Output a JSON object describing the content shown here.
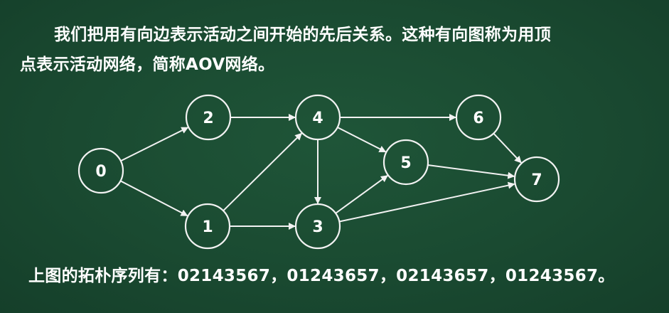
{
  "text": {
    "para_line1": "我们把用有向边表示活动之间开始的先后关系。这种有向图称为用顶",
    "para_line2": "点表示活动网络，简称AOV网络。",
    "sequence": "上图的拓朴序列有：02143567，01243657，02143657，01243567。"
  },
  "graph": {
    "nodes": [
      {
        "id": "0",
        "label": "0"
      },
      {
        "id": "1",
        "label": "1"
      },
      {
        "id": "2",
        "label": "2"
      },
      {
        "id": "3",
        "label": "3"
      },
      {
        "id": "4",
        "label": "4"
      },
      {
        "id": "5",
        "label": "5"
      },
      {
        "id": "6",
        "label": "6"
      },
      {
        "id": "7",
        "label": "7"
      }
    ],
    "edges": [
      {
        "from": "0",
        "to": "2"
      },
      {
        "from": "0",
        "to": "1"
      },
      {
        "from": "2",
        "to": "4"
      },
      {
        "from": "1",
        "to": "4"
      },
      {
        "from": "1",
        "to": "3"
      },
      {
        "from": "4",
        "to": "3"
      },
      {
        "from": "4",
        "to": "5"
      },
      {
        "from": "4",
        "to": "6"
      },
      {
        "from": "3",
        "to": "5"
      },
      {
        "from": "3",
        "to": "7"
      },
      {
        "from": "5",
        "to": "7"
      },
      {
        "from": "6",
        "to": "7"
      }
    ]
  },
  "colors": {
    "background": "#1a4a31",
    "foreground": "#ffffff"
  }
}
